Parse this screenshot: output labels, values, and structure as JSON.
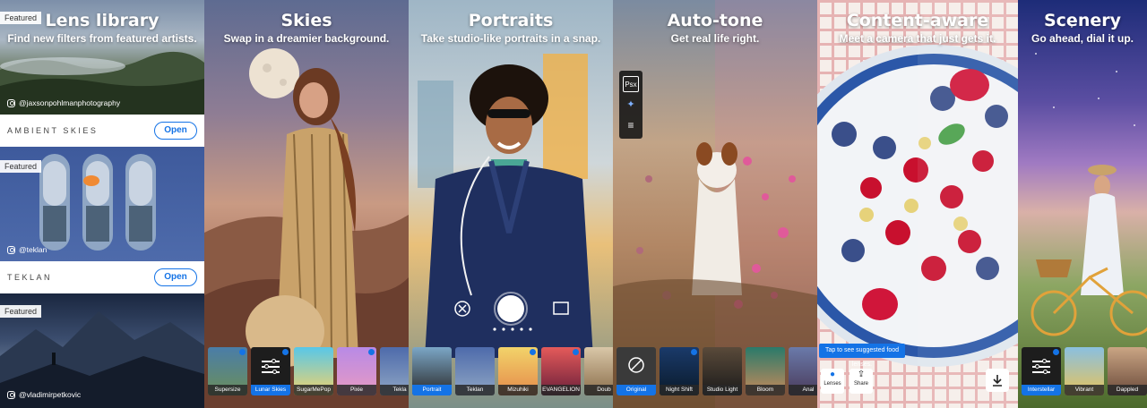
{
  "panels": {
    "lens_library": {
      "title": "Lens library",
      "subtitle": "Find new filters from featured artists.",
      "featured_label": "Featured",
      "cards": [
        {
          "credit": "@jaxsonpohlmanphotography",
          "lens": "AMBIENT SKIES",
          "button": "Open"
        },
        {
          "credit": "@teklan",
          "lens": "TEKLAN",
          "button": "Open"
        },
        {
          "credit": "@vladimirpetkovic"
        }
      ]
    },
    "skies": {
      "title": "Skies",
      "subtitle": "Swap in a dreamier background.",
      "thumbs": [
        "Supersize",
        "Lunar Skies",
        "SugarMePop",
        "Pixie",
        "Tekla"
      ]
    },
    "portraits": {
      "title": "Portraits",
      "subtitle": "Take studio-like portraits in a snap.",
      "thumbs": [
        "Portrait",
        "Teklan",
        "Mizuhiki",
        "EVANGELION",
        "Doub"
      ]
    },
    "auto_tone": {
      "title": "Auto-tone",
      "subtitle": "Get real life right.",
      "tools": [
        "Psx",
        "✦",
        "≡"
      ],
      "thumbs": [
        "Original",
        "Night Shift",
        "Studio Light",
        "Bloom",
        "Anal"
      ]
    },
    "content_aware": {
      "title": "Content-aware",
      "subtitle": "Meet a camera that just gets it.",
      "tooltip": "Tap to see suggested food lenses.",
      "lenses_label": "Lenses",
      "share_label": "Share"
    },
    "scenery": {
      "title": "Scenery",
      "subtitle": "Go ahead, dial it up.",
      "thumbs": [
        "Interstellar",
        "Vibrant",
        "Dappled"
      ]
    }
  },
  "colors": {
    "accent": "#1473e6"
  }
}
